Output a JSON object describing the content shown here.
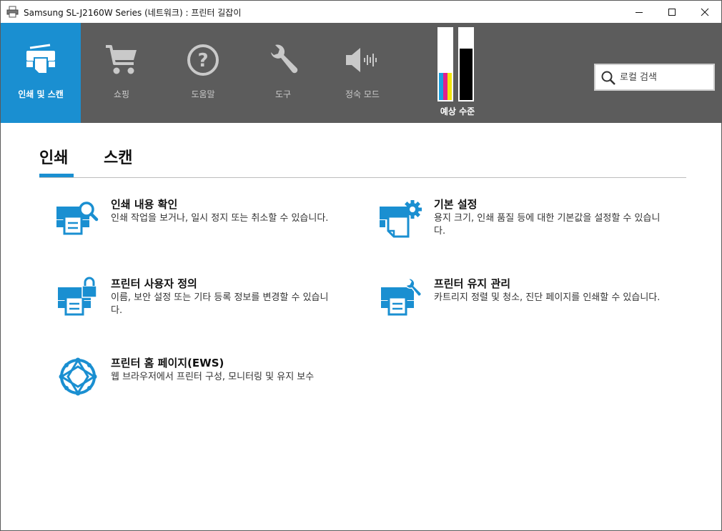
{
  "window": {
    "title": "Samsung SL-J2160W Series (네트워크) : 프린터 길잡이"
  },
  "toolbar": {
    "items": [
      {
        "label": "인쇄 및 스캔",
        "icon": "print-scan-icon",
        "active": true
      },
      {
        "label": "쇼핑",
        "icon": "shopping-cart-icon",
        "active": false
      },
      {
        "label": "도움말",
        "icon": "help-icon",
        "active": false
      },
      {
        "label": "도구",
        "icon": "wrench-icon",
        "active": false
      },
      {
        "label": "정숙 모드",
        "icon": "quiet-mode-icon",
        "active": false
      }
    ],
    "ink_label": "예상 수준",
    "search_placeholder": "로컬 검색"
  },
  "ink_levels": {
    "color": 0.38,
    "black": 0.72
  },
  "tabs": [
    {
      "label": "인쇄",
      "active": true
    },
    {
      "label": "스캔",
      "active": false
    }
  ],
  "items": [
    {
      "title": "인쇄 내용 확인",
      "desc": "인쇄 작업을 보거나, 일시 정지 또는 취소할 수 있습니다.",
      "icon": "print-queue-icon"
    },
    {
      "title": "기본 설정",
      "desc": "용지 크기, 인쇄 품질 등에 대한 기본값을 설정할 수 있습니다.",
      "icon": "preferences-icon"
    },
    {
      "title": "프린터 사용자 정의",
      "desc": "이름, 보안 설정 또는 기타 등록 정보를 변경할 수 있습니다.",
      "icon": "printer-lock-icon"
    },
    {
      "title": "프린터 유지 관리",
      "desc": "카트리지 정렬 및 청소, 진단 페이지를 인쇄할 수 있습니다.",
      "icon": "printer-maintenance-icon"
    },
    {
      "title": "프린터 홈 페이지(EWS)",
      "desc": "웹 브라우저에서 프린터 구성, 모니터링 및 유지 보수",
      "icon": "globe-icon"
    }
  ],
  "colors": {
    "accent": "#1a8fd1",
    "toolbar_bg": "#5c5c5c",
    "toolbar_text": "#c9c9c9",
    "ink_cyan": "#1a9fe0",
    "ink_magenta": "#e0208c",
    "ink_yellow": "#f2e60c"
  }
}
